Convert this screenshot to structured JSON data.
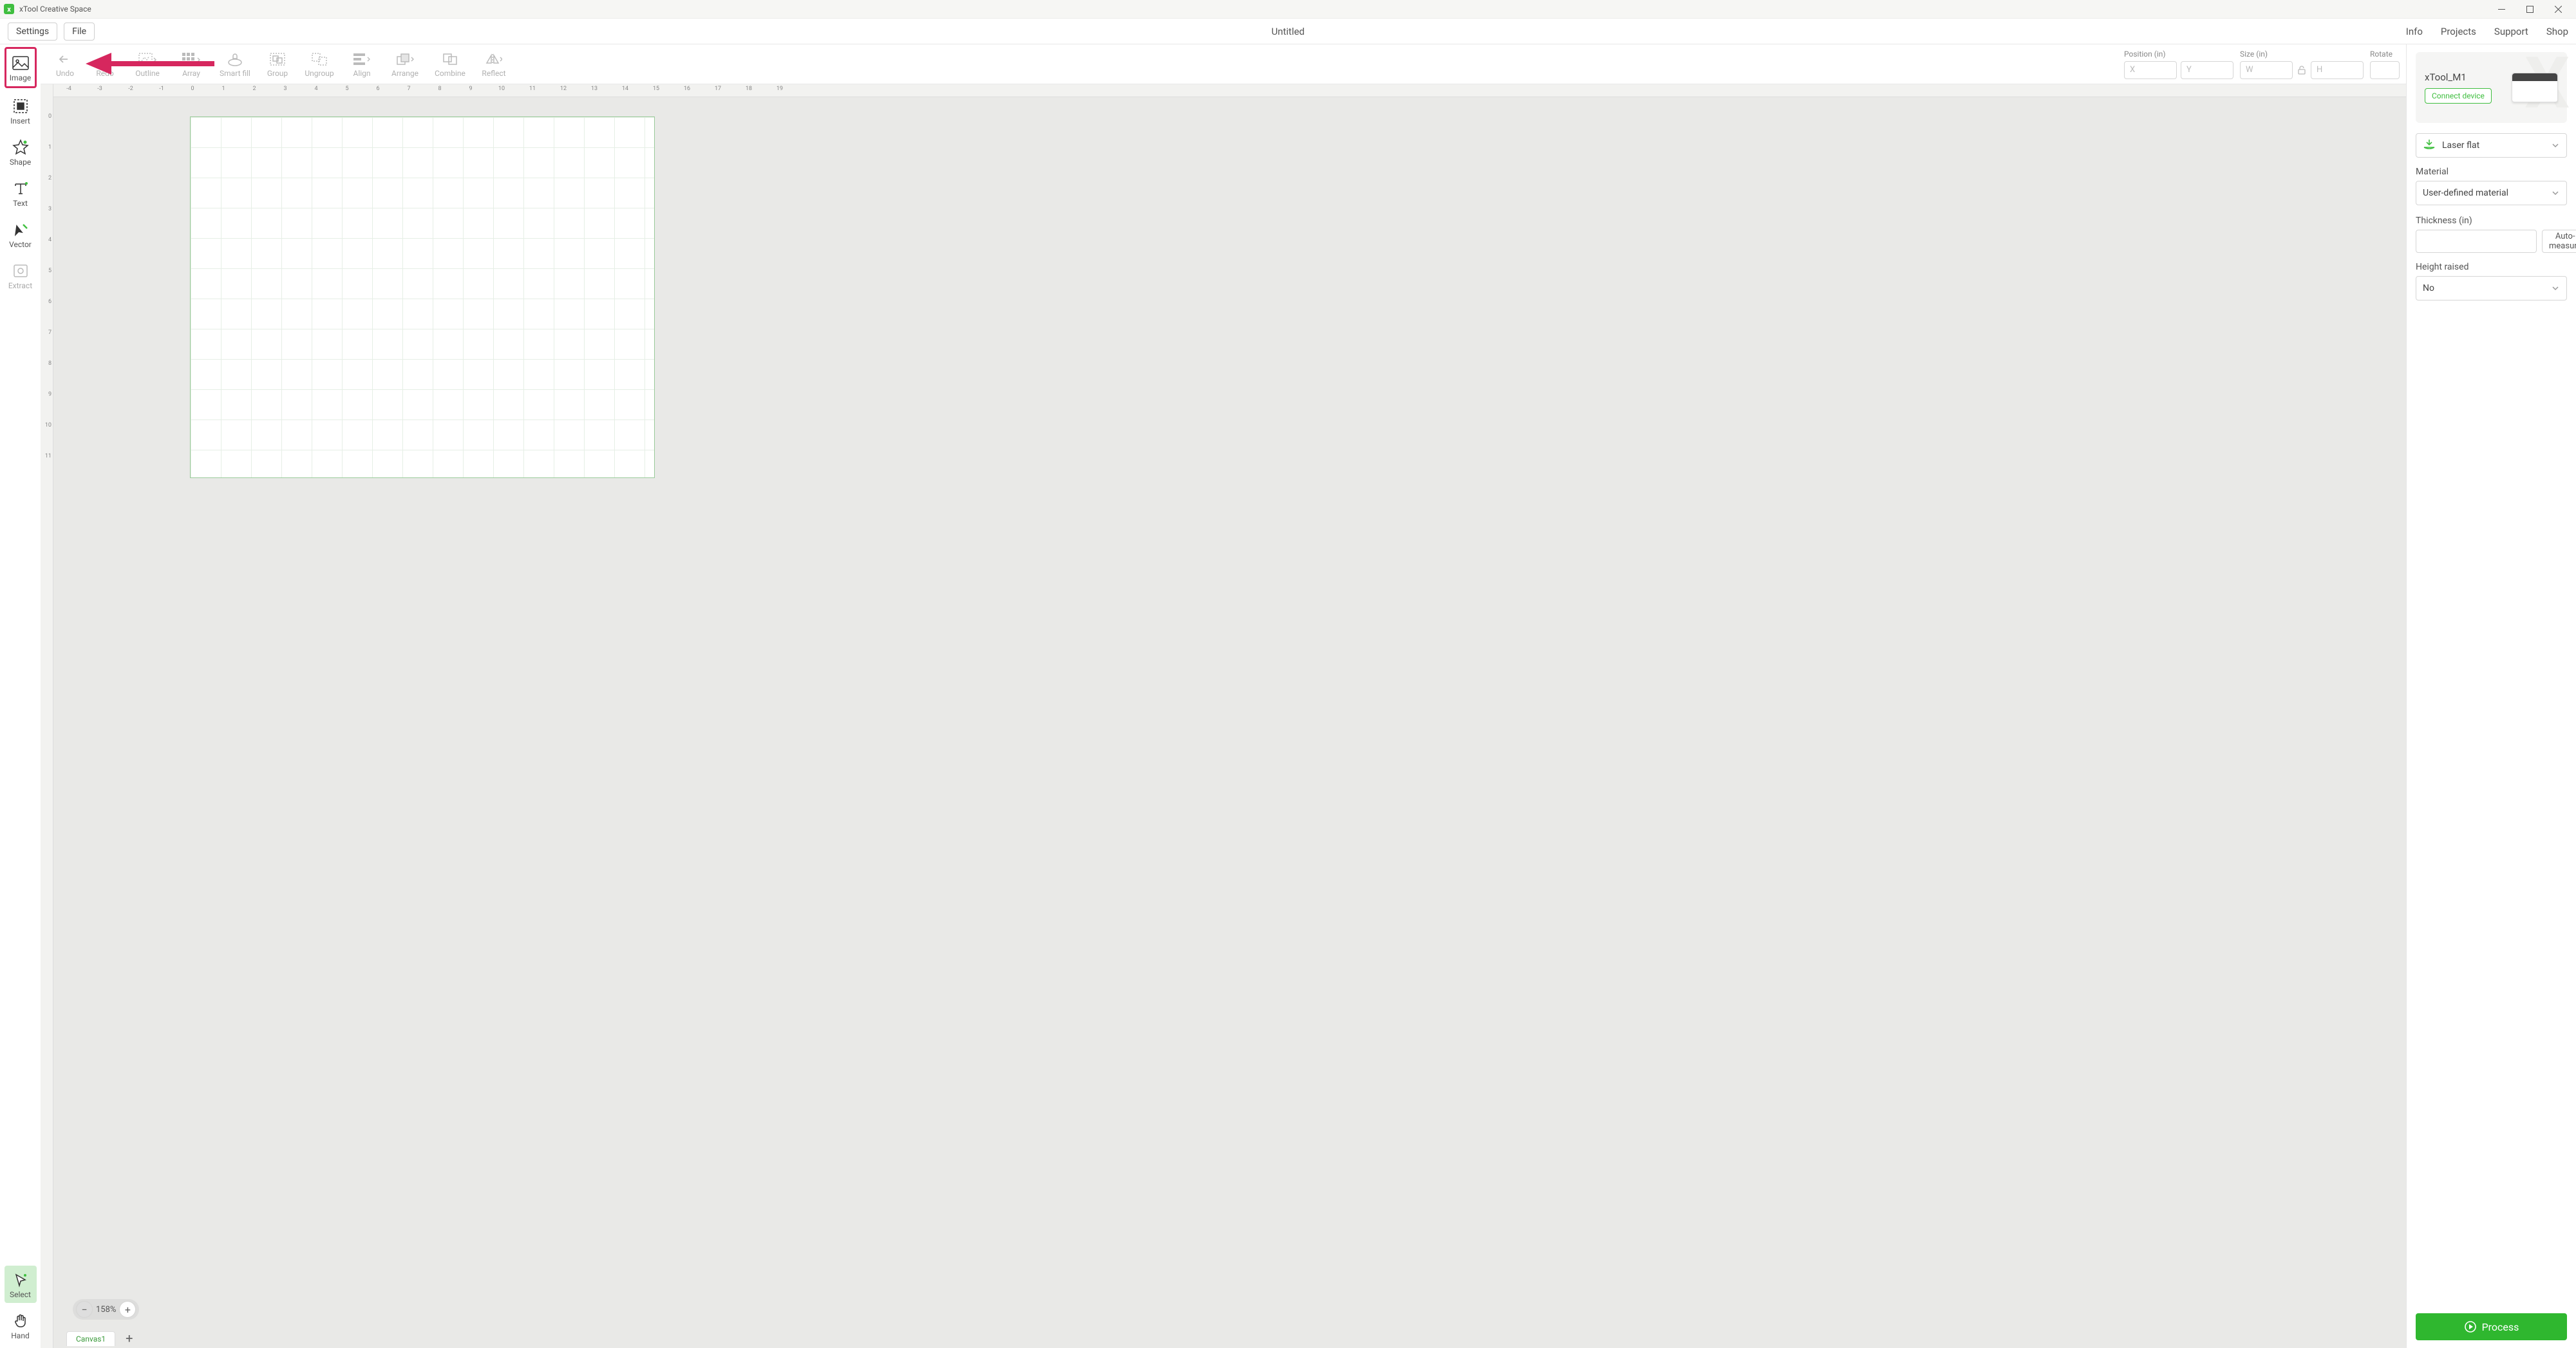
{
  "titlebar": {
    "app": "xTool Creative Space"
  },
  "menu": {
    "settings": "Settings",
    "file": "File",
    "document": "Untitled",
    "links": [
      "Info",
      "Projects",
      "Support",
      "Shop"
    ]
  },
  "left_tools": [
    {
      "id": "image",
      "label": "Image",
      "highlighted": true
    },
    {
      "id": "insert",
      "label": "Insert"
    },
    {
      "id": "shape",
      "label": "Shape"
    },
    {
      "id": "text",
      "label": "Text"
    },
    {
      "id": "vector",
      "label": "Vector"
    },
    {
      "id": "extract",
      "label": "Extract",
      "disabled": true
    }
  ],
  "bottom_tools": [
    {
      "id": "select",
      "label": "Select",
      "active": true
    },
    {
      "id": "hand",
      "label": "Hand"
    }
  ],
  "toolbar": {
    "items": [
      {
        "id": "undo",
        "label": "Undo"
      },
      {
        "id": "redo",
        "label": "Redo"
      },
      {
        "id": "outline",
        "label": "Outline"
      },
      {
        "id": "array",
        "label": "Array"
      },
      {
        "id": "smartfill",
        "label": "Smart fill"
      },
      {
        "id": "group",
        "label": "Group"
      },
      {
        "id": "ungroup",
        "label": "Ungroup"
      },
      {
        "id": "align",
        "label": "Align"
      },
      {
        "id": "arrange",
        "label": "Arrange"
      },
      {
        "id": "combine",
        "label": "Combine"
      },
      {
        "id": "reflect",
        "label": "Reflect"
      }
    ],
    "position_label": "Position (in)",
    "size_label": "Size (in)",
    "rotate_label": "Rotate",
    "placeholders": {
      "x": "X",
      "y": "Y",
      "w": "W",
      "h": "H"
    }
  },
  "ruler_h": [
    "-4",
    "-3",
    "-2",
    "-1",
    "0",
    "1",
    "2",
    "3",
    "4",
    "5",
    "6",
    "7",
    "8",
    "9",
    "10",
    "11",
    "12",
    "13",
    "14",
    "15",
    "16",
    "17",
    "18",
    "19"
  ],
  "ruler_v": [
    "0",
    "1",
    "2",
    "3",
    "4",
    "5",
    "6",
    "7",
    "8",
    "9",
    "10",
    "11"
  ],
  "zoom": "158%",
  "tabs": {
    "active": "Canvas1"
  },
  "right": {
    "device": "xTool_M1",
    "connect": "Connect device",
    "mode": "Laser flat",
    "material_label": "Material",
    "material": "User-defined material",
    "thickness_label": "Thickness (in)",
    "thickness": "",
    "auto": "Auto-measure",
    "height_label": "Height raised",
    "height": "No",
    "process": "Process"
  }
}
